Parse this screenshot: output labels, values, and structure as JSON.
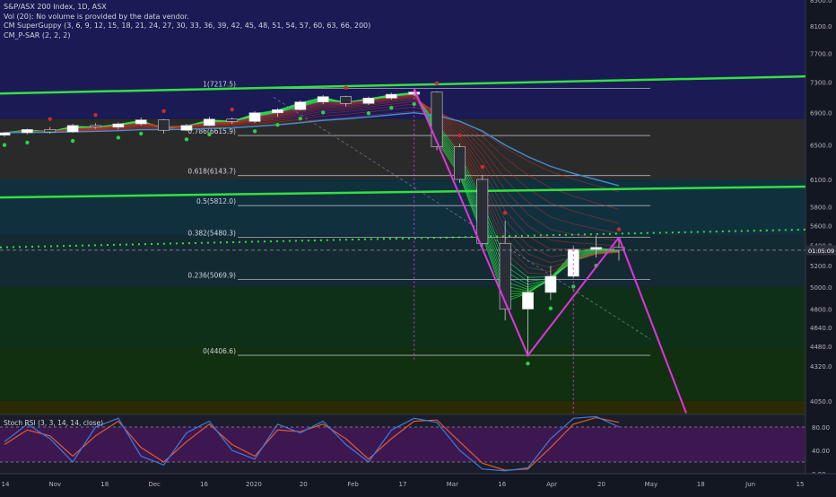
{
  "legend": {
    "title": "S&P/ASX 200 Index, 1D, ASX",
    "vol": "Vol (20): No volume is provided by the data vendor.",
    "guppy": "CM SuperGuppy (3, 6, 9, 12, 15, 18, 21, 24, 27, 30, 33, 36, 39, 42, 45, 48, 51, 54, 57, 60, 63, 66, 200)",
    "psar": "CM_P-SAR (2, 2, 2)",
    "stoch": "Stoch RSI (3, 3, 14, 14, close)"
  },
  "colors": {
    "background": "#131722",
    "price_up": "#ffffff",
    "price_down": "#e0e0e0",
    "guppy_fast_bull": "#2ee84e",
    "guppy_slow_bear": "#c0392b",
    "ema200": "#3f8fd4",
    "psar_bull": "#28d14a",
    "psar_bear": "#d02b2b",
    "trend_green": "#33e03f",
    "pattern": "#e234dd",
    "stoch_k": "#3b7ddd",
    "stoch_d": "#e15a31",
    "stoch_bg": "#3d1750"
  },
  "chart_data": {
    "type": "candlestick",
    "y_scale": "log",
    "ylim": [
      3950,
      8500
    ],
    "price_ticks": [
      "8500.0",
      "8100.0",
      "7700.0",
      "7300.0",
      "6900.0",
      "6500.0",
      "6100.0",
      "5800.0",
      "5600.0",
      "5400.0",
      "5200.0",
      "5000.0",
      "4800.0",
      "4640.0",
      "4480.0",
      "4320.0",
      "4050.0"
    ],
    "x_labels": [
      "14",
      "Nov",
      "18",
      "Dec",
      "16",
      "2020",
      "20",
      "Feb",
      "17",
      "Mar",
      "16",
      "Apr",
      "20",
      "May",
      "18",
      "Jun",
      "15"
    ],
    "current_price": "5351.95",
    "current_price_label": "01:05:09",
    "fib_levels": [
      {
        "label": "1(7217.5)",
        "value": 7217.5
      },
      {
        "label": "0.786(6615.9)",
        "value": 6615.9
      },
      {
        "label": "0.618(6143.7)",
        "value": 6143.7
      },
      {
        "label": "0.5(5812.0)",
        "value": 5812.0
      },
      {
        "label": "0.382(5480.3)",
        "value": 5480.3
      },
      {
        "label": "0.236(5069.9)",
        "value": 5069.9
      },
      {
        "label": "0(4406.6)",
        "value": 4406.6
      }
    ],
    "zone_boundaries": [
      8500,
      6820,
      6100,
      5500,
      5000,
      4480,
      4050,
      3950
    ],
    "candles": [
      {
        "date": "2019-10-14",
        "o": 6620,
        "h": 6660,
        "l": 6600,
        "c": 6650
      },
      {
        "date": "2019-10-21",
        "o": 6650,
        "h": 6700,
        "l": 6630,
        "c": 6690
      },
      {
        "date": "2019-10-28",
        "o": 6690,
        "h": 6720,
        "l": 6640,
        "c": 6660
      },
      {
        "date": "2019-11-04",
        "o": 6660,
        "h": 6760,
        "l": 6650,
        "c": 6740
      },
      {
        "date": "2019-11-11",
        "o": 6740,
        "h": 6770,
        "l": 6700,
        "c": 6720
      },
      {
        "date": "2019-11-18",
        "o": 6720,
        "h": 6780,
        "l": 6690,
        "c": 6760
      },
      {
        "date": "2019-11-25",
        "o": 6760,
        "h": 6840,
        "l": 6740,
        "c": 6810
      },
      {
        "date": "2019-12-02",
        "o": 6810,
        "h": 6820,
        "l": 6640,
        "c": 6680
      },
      {
        "date": "2019-12-09",
        "o": 6680,
        "h": 6760,
        "l": 6670,
        "c": 6740
      },
      {
        "date": "2019-12-16",
        "o": 6740,
        "h": 6850,
        "l": 6730,
        "c": 6820
      },
      {
        "date": "2019-12-23",
        "o": 6820,
        "h": 6840,
        "l": 6760,
        "c": 6790
      },
      {
        "date": "2019-12-30",
        "o": 6790,
        "h": 6920,
        "l": 6770,
        "c": 6900
      },
      {
        "date": "2020-01-06",
        "o": 6900,
        "h": 6960,
        "l": 6850,
        "c": 6940
      },
      {
        "date": "2020-01-13",
        "o": 6940,
        "h": 7060,
        "l": 6930,
        "c": 7040
      },
      {
        "date": "2020-01-20",
        "o": 7040,
        "h": 7130,
        "l": 7010,
        "c": 7110
      },
      {
        "date": "2020-01-27",
        "o": 7110,
        "h": 7120,
        "l": 6980,
        "c": 7020
      },
      {
        "date": "2020-02-03",
        "o": 7020,
        "h": 7110,
        "l": 7000,
        "c": 7090
      },
      {
        "date": "2020-02-10",
        "o": 7090,
        "h": 7160,
        "l": 7070,
        "c": 7140
      },
      {
        "date": "2020-02-17",
        "o": 7140,
        "h": 7217,
        "l": 7120,
        "c": 7170
      },
      {
        "date": "2020-02-24",
        "o": 7170,
        "h": 7180,
        "l": 6440,
        "c": 6480
      },
      {
        "date": "2020-03-02",
        "o": 6480,
        "h": 6520,
        "l": 6060,
        "c": 6100
      },
      {
        "date": "2020-03-09",
        "o": 6100,
        "h": 6150,
        "l": 5350,
        "c": 5420
      },
      {
        "date": "2020-03-16",
        "o": 5420,
        "h": 5650,
        "l": 4700,
        "c": 4800
      },
      {
        "date": "2020-03-23",
        "o": 4800,
        "h": 5100,
        "l": 4406,
        "c": 4950
      },
      {
        "date": "2020-03-30",
        "o": 4950,
        "h": 5200,
        "l": 4880,
        "c": 5100
      },
      {
        "date": "2020-04-06",
        "o": 5100,
        "h": 5390,
        "l": 5080,
        "c": 5360
      },
      {
        "date": "2020-04-13",
        "o": 5360,
        "h": 5500,
        "l": 5280,
        "c": 5380
      },
      {
        "date": "2020-04-20",
        "o": 5380,
        "h": 5480,
        "l": 5250,
        "c": 5352
      }
    ],
    "stoch_ticks": [
      "80.00",
      "40.00",
      "0.00"
    ],
    "stoch_bands": {
      "upper": 80,
      "lower": 20
    },
    "stoch_k": [
      55,
      85,
      60,
      20,
      80,
      95,
      30,
      15,
      70,
      90,
      40,
      25,
      85,
      70,
      90,
      50,
      20,
      75,
      95,
      88,
      40,
      8,
      5,
      10,
      60,
      95,
      98,
      80
    ],
    "stoch_d": [
      50,
      75,
      65,
      30,
      65,
      90,
      45,
      20,
      55,
      85,
      50,
      30,
      75,
      72,
      85,
      60,
      25,
      60,
      90,
      92,
      55,
      18,
      6,
      8,
      45,
      85,
      96,
      88
    ]
  }
}
